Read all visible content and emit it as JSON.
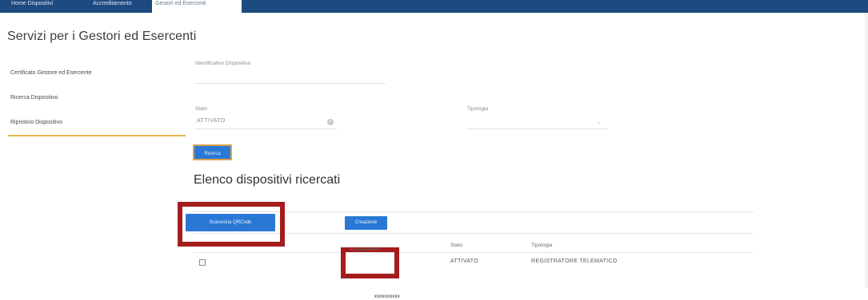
{
  "topbar": {
    "tabs": [
      {
        "label": "Home Dispositivi"
      },
      {
        "label": "Accreditamento"
      },
      {
        "label": "Gestori ed Esercenti"
      }
    ]
  },
  "page": {
    "title": "Servizi per i Gestori ed Esercenti"
  },
  "sidebar": {
    "items": [
      {
        "label": "Certificato Gestore ed Esercente"
      },
      {
        "label": "Ricerca Dispositivo"
      },
      {
        "label": "Ripristino Dispositivo"
      }
    ]
  },
  "form": {
    "identificativo": {
      "label": "Identificativo Dispositivo",
      "value": ""
    },
    "stato": {
      "label": "Stato",
      "value": "ATTIVATO"
    },
    "tipologia": {
      "label": "Tipologia",
      "value": ""
    },
    "search_button": "Ricerca"
  },
  "results": {
    "title": "Elenco dispositivi ricercati",
    "scan_button": "Scansiona QRCode",
    "create_button": "Creazione",
    "columns": [
      "Id dispositivo",
      "Stato",
      "Tipologia"
    ],
    "rows": [
      {
        "id": "",
        "stato": "ATTIVATO",
        "tipologia": "REGISTRATORE TELEMATICO"
      }
    ]
  },
  "footer": {
    "text": "xxxxxxxxxx"
  },
  "colors": {
    "topbar": "#1d4a80",
    "button": "#2a78d6",
    "highlight": "#a41c1c",
    "tab_accent": "#e8b54a"
  }
}
